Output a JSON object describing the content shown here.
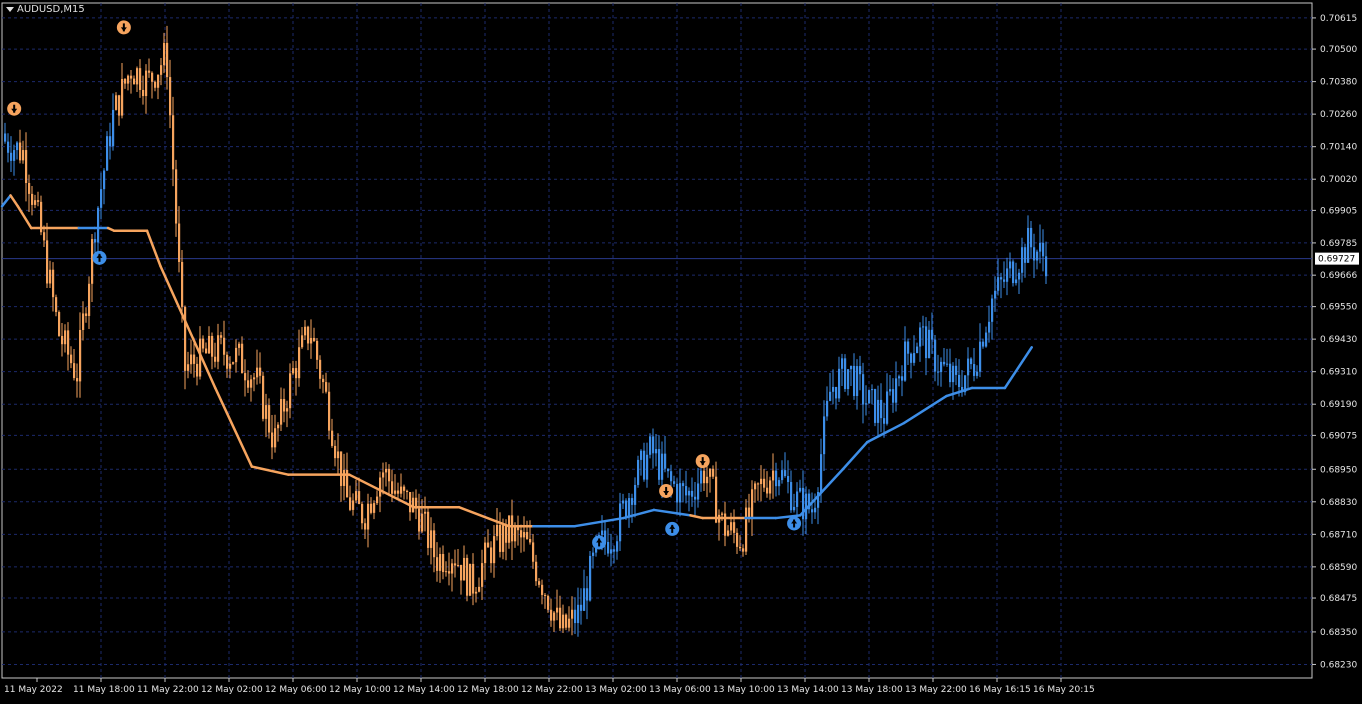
{
  "header": {
    "symbol": "AUDUSD,M15"
  },
  "current_price": "0.69727",
  "colors": {
    "background": "#000000",
    "grid": "#1c2a6b",
    "bear": "#f6a45e",
    "bull": "#3d8ee8",
    "axis_text": "#e6e6e6",
    "price_line": "#2a3a8c"
  },
  "chart_data": {
    "type": "candlestick",
    "title": "",
    "symbol": "AUDUSD",
    "timeframe": "M15",
    "ylim": [
      0.6818,
      0.7067
    ],
    "y_ticks": [
      "0.70615",
      "0.70500",
      "0.70380",
      "0.70260",
      "0.70140",
      "0.70020",
      "0.69905",
      "0.69785",
      "0.69666",
      "0.69550",
      "0.69430",
      "0.69310",
      "0.69190",
      "0.69075",
      "0.68950",
      "0.68830",
      "0.68710",
      "0.68590",
      "0.68475",
      "0.68350",
      "0.68230"
    ],
    "x_ticks": [
      "11 May 2022",
      "11 May 18:00",
      "11 May 22:00",
      "12 May 02:00",
      "12 May 06:00",
      "12 May 10:00",
      "12 May 14:00",
      "12 May 18:00",
      "12 May 22:00",
      "13 May 02:00",
      "13 May 06:00",
      "13 May 10:00",
      "13 May 14:00",
      "13 May 18:00",
      "13 May 22:00",
      "16 May 16:15",
      "16 May 20:15"
    ],
    "grid": true,
    "approx_close_path": [
      0.7016,
      0.7012,
      0.6982,
      0.6945,
      0.693,
      0.6985,
      0.7025,
      0.7043,
      0.7038,
      0.7048,
      0.6932,
      0.6937,
      0.6939,
      0.6936,
      0.6928,
      0.6905,
      0.693,
      0.6947,
      0.6918,
      0.6884,
      0.6878,
      0.6895,
      0.6885,
      0.688,
      0.6862,
      0.6864,
      0.6852,
      0.6865,
      0.6872,
      0.6868,
      0.6852,
      0.6835,
      0.6842,
      0.6866,
      0.6872,
      0.689,
      0.6902,
      0.689,
      0.6885,
      0.6895,
      0.6874,
      0.6869,
      0.6888,
      0.6896,
      0.6884,
      0.688,
      0.6925,
      0.6932,
      0.692,
      0.6915,
      0.6935,
      0.6945,
      0.6934,
      0.6926,
      0.6934,
      0.6958,
      0.6968,
      0.6978,
      0.6973
    ],
    "trail_line": [
      {
        "x": 0,
        "y": 0.6992,
        "trend": "bull"
      },
      {
        "x": 0.7,
        "y": 0.6996,
        "trend": "bull"
      },
      {
        "x": 1.3,
        "y": 0.6992,
        "trend": "bear"
      },
      {
        "x": 2.4,
        "y": 0.6984,
        "trend": "bear"
      },
      {
        "x": 6.3,
        "y": 0.6984,
        "trend": "bear"
      },
      {
        "x": 7.6,
        "y": 0.6984,
        "trend": "bull"
      },
      {
        "x": 8.7,
        "y": 0.6984,
        "trend": "bull"
      },
      {
        "x": 9.2,
        "y": 0.6983,
        "trend": "bear"
      },
      {
        "x": 11.9,
        "y": 0.6983,
        "trend": "bear"
      },
      {
        "x": 13,
        "y": 0.697,
        "trend": "bear"
      },
      {
        "x": 17.5,
        "y": 0.6925,
        "trend": "bear"
      },
      {
        "x": 20.5,
        "y": 0.6896,
        "trend": "bear"
      },
      {
        "x": 23.5,
        "y": 0.6893,
        "trend": "bear"
      },
      {
        "x": 28.5,
        "y": 0.6893,
        "trend": "bear"
      },
      {
        "x": 33.8,
        "y": 0.6881,
        "trend": "bear"
      },
      {
        "x": 37.5,
        "y": 0.6881,
        "trend": "bear"
      },
      {
        "x": 41.6,
        "y": 0.6874,
        "trend": "bear"
      },
      {
        "x": 43.6,
        "y": 0.6874,
        "trend": "bear"
      },
      {
        "x": 47,
        "y": 0.6874,
        "trend": "bull"
      },
      {
        "x": 51,
        "y": 0.6877,
        "trend": "bull"
      },
      {
        "x": 53.5,
        "y": 0.688,
        "trend": "bull"
      },
      {
        "x": 56.5,
        "y": 0.6878,
        "trend": "bull"
      },
      {
        "x": 57.5,
        "y": 0.6877,
        "trend": "bear"
      },
      {
        "x": 61,
        "y": 0.6877,
        "trend": "bear"
      },
      {
        "x": 63.5,
        "y": 0.6877,
        "trend": "bull"
      },
      {
        "x": 65.5,
        "y": 0.6878,
        "trend": "bull"
      },
      {
        "x": 69,
        "y": 0.6895,
        "trend": "bull"
      },
      {
        "x": 71,
        "y": 0.6905,
        "trend": "bull"
      },
      {
        "x": 74,
        "y": 0.6912,
        "trend": "bull"
      },
      {
        "x": 77.5,
        "y": 0.6922,
        "trend": "bull"
      },
      {
        "x": 79.6,
        "y": 0.6925,
        "trend": "bull"
      },
      {
        "x": 82.3,
        "y": 0.6925,
        "trend": "bull"
      },
      {
        "x": 84.5,
        "y": 0.694,
        "trend": "bull"
      }
    ],
    "signals": [
      {
        "x": 1.0,
        "y": 0.7028,
        "type": "sell"
      },
      {
        "x": 8.0,
        "y": 0.6973,
        "type": "buy"
      },
      {
        "x": 10.0,
        "y": 0.7058,
        "type": "sell"
      },
      {
        "x": 49.0,
        "y": 0.6868,
        "type": "buy"
      },
      {
        "x": 54.5,
        "y": 0.6887,
        "type": "sell"
      },
      {
        "x": 55.0,
        "y": 0.6873,
        "type": "buy"
      },
      {
        "x": 57.5,
        "y": 0.6898,
        "type": "sell"
      },
      {
        "x": 65.0,
        "y": 0.6875,
        "type": "buy"
      }
    ],
    "x_count": 86
  }
}
